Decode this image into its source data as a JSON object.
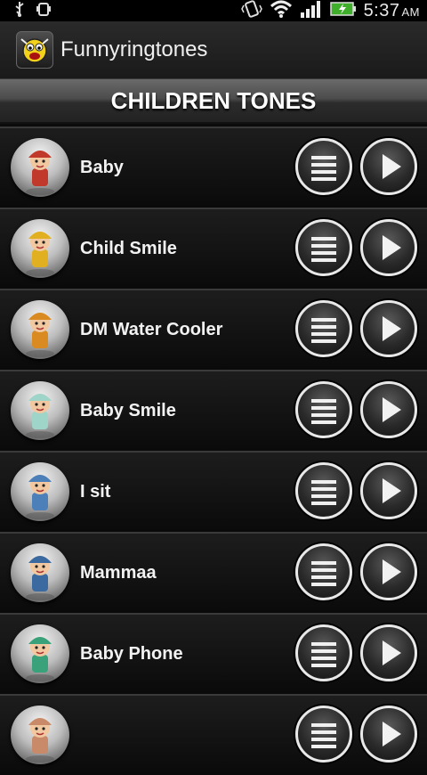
{
  "status": {
    "time": "5:37",
    "ampm": "AM",
    "icons": [
      "usb-icon",
      "debug-icon",
      "vibrate-icon",
      "wifi-icon",
      "signal-icon",
      "battery-icon"
    ]
  },
  "app": {
    "title": "Funnyringtones",
    "icon": "app-logo-icon"
  },
  "category": {
    "title": "CHILDREN TONES"
  },
  "tones": [
    {
      "label": "Baby",
      "avatar": "pirate-child",
      "color": "#c0392b"
    },
    {
      "label": "Child Smile",
      "avatar": "sombrero-child",
      "color": "#e0b020"
    },
    {
      "label": "DM Water Cooler",
      "avatar": "sombrero-child-small",
      "color": "#d98a20"
    },
    {
      "label": "Baby Smile",
      "avatar": "statue-child",
      "color": "#9fd4c8"
    },
    {
      "label": "I sit",
      "avatar": "boy-blue",
      "color": "#4d7fb8"
    },
    {
      "label": "Mammaa",
      "avatar": "boy-blue-camera",
      "color": "#3b6aa0"
    },
    {
      "label": "Baby Phone",
      "avatar": "girl-phone",
      "color": "#3aa27a"
    },
    {
      "label": "",
      "avatar": "partial-next",
      "color": "#c98a6a"
    }
  ]
}
